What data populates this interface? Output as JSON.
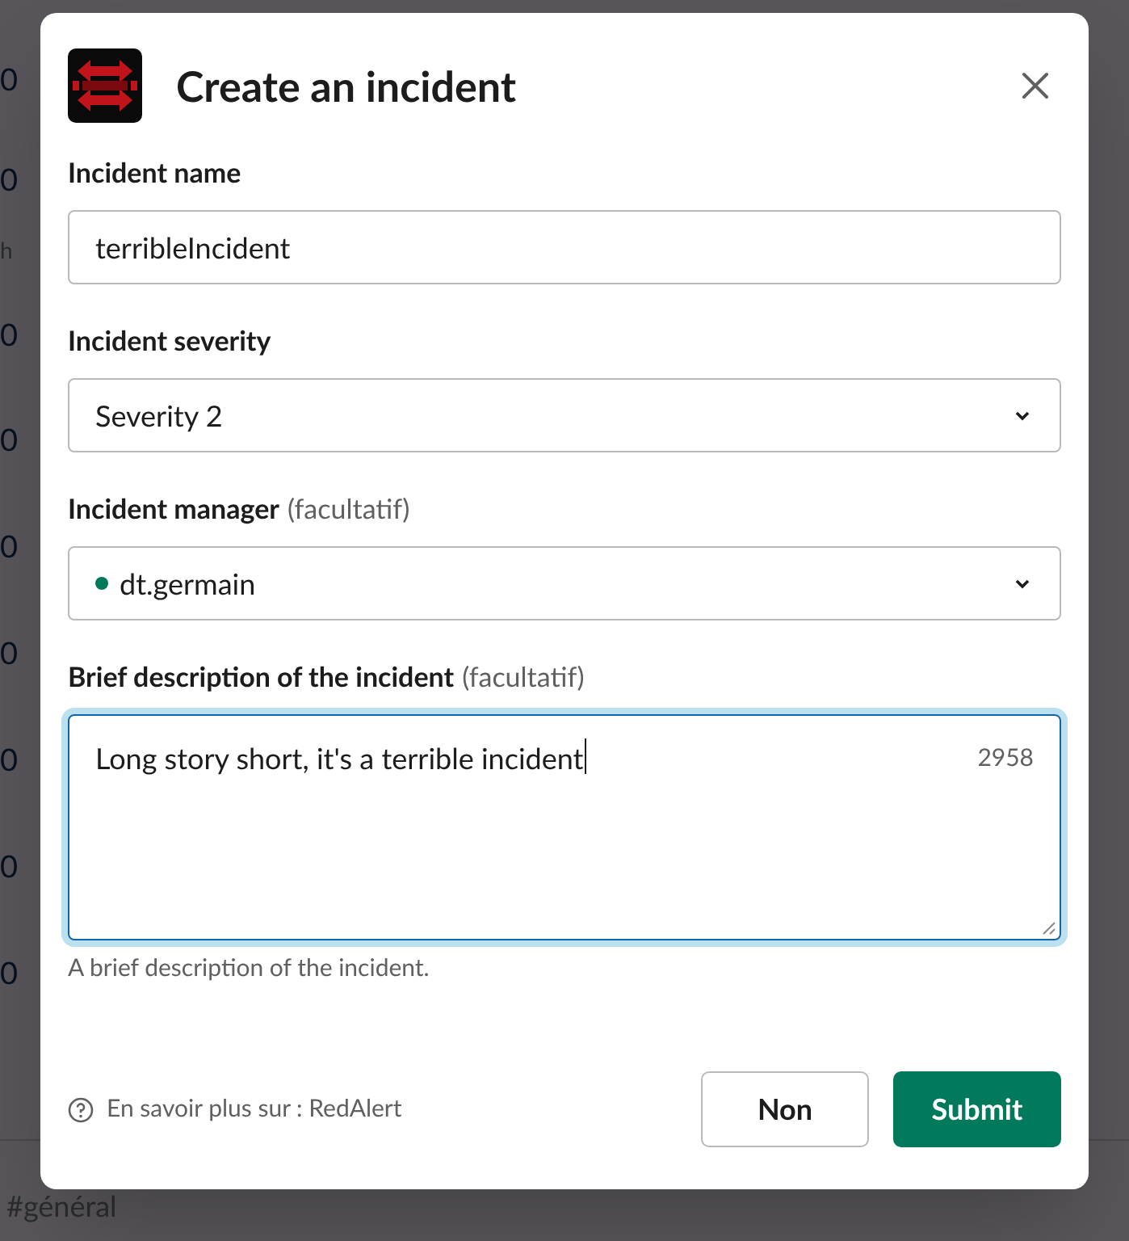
{
  "background": {
    "edge_texts": [
      "0",
      "0",
      "h",
      "0",
      "0",
      "0",
      "0",
      "0",
      "0",
      "0"
    ],
    "channel": "#général"
  },
  "modal": {
    "title": "Create an incident",
    "fields": [
      {
        "kind": "text",
        "label": "Incident name",
        "value": "terribleIncident"
      },
      {
        "kind": "select",
        "label": "Incident severity",
        "value": "Severity 2"
      },
      {
        "kind": "user",
        "label": "Incident manager",
        "optional": "(facultatif)",
        "value": "dt.germain",
        "color": "#007a5a"
      },
      {
        "kind": "textarea",
        "label": "Brief description of the incident",
        "optional": "(facultatif)",
        "value": "Long story short, it's a terrible incident",
        "counter": "2958",
        "focused": true,
        "hint": "A brief description of the incident."
      }
    ],
    "help_link": "En savoir plus sur : RedAlert",
    "buttons": [
      {
        "label": "Non",
        "kind": "secondary"
      },
      {
        "label": "Submit",
        "kind": "primary"
      }
    ]
  }
}
